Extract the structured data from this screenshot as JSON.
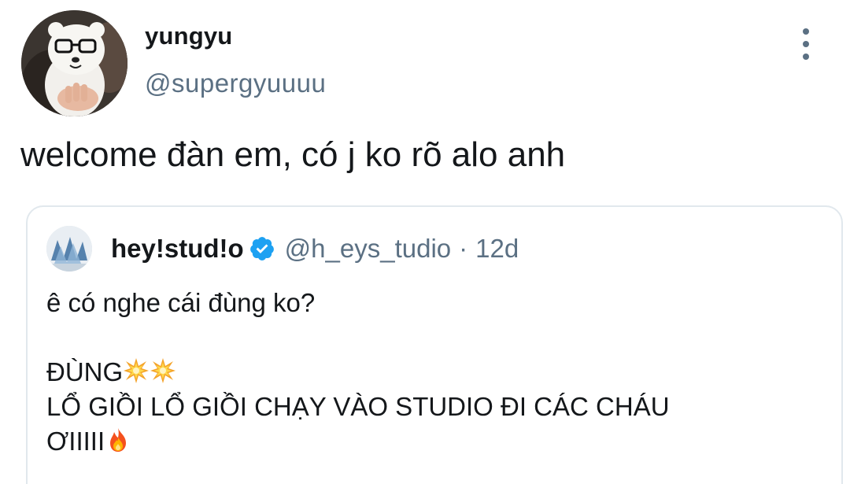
{
  "tweet": {
    "display_name": "yungyu",
    "handle": "@supergyuuuu",
    "text": "welcome đàn em, có j ko rõ alo anh"
  },
  "quoted_tweet": {
    "display_name": "hey!stud!o",
    "verified": true,
    "handle": "@h_eys_tudio",
    "separator": "·",
    "time": "12d",
    "lines": [
      "ê có nghe cái đùng ko?",
      "",
      "ĐÙNG",
      "LỔ GIỒI LỔ GIỒI CHẠY VÀO STUDIO ĐI CÁC CHÁU",
      "ƠIIIII"
    ],
    "emojis": {
      "line3": [
        "collision-emoji",
        "collision-emoji"
      ],
      "line5": [
        "fire-emoji"
      ]
    }
  },
  "icons": {
    "more": "more-vertical-icon",
    "verified": "verified-badge-icon"
  },
  "colors": {
    "text_primary": "#14171a",
    "text_secondary": "#5b7083",
    "verified_blue": "#1da1f2",
    "border": "#e1e8ed"
  }
}
